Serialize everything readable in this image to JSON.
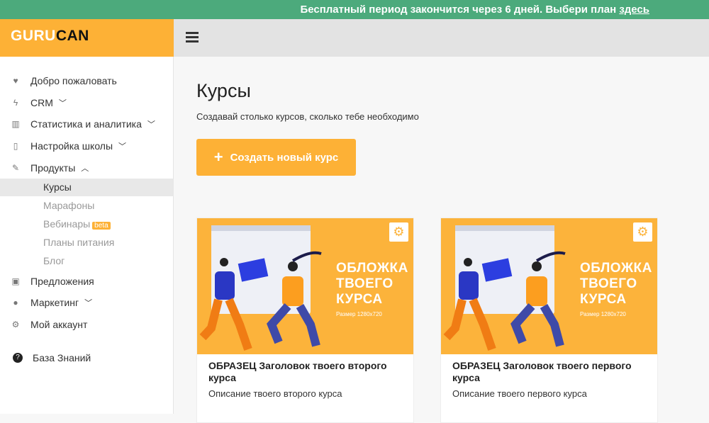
{
  "trial_banner": {
    "text": "Бесплатный период закончится через 6 дней. Выбери план ",
    "link": "здесь"
  },
  "logo": {
    "part1": "GURU",
    "part2": "CAN"
  },
  "sidebar": {
    "items": [
      {
        "label": "Добро пожаловать",
        "icon": "heart-icon"
      },
      {
        "label": "CRM",
        "icon": "bolt-icon"
      },
      {
        "label": "Статистика и аналитика",
        "icon": "chart-icon"
      },
      {
        "label": "Настройка школы",
        "icon": "phone-icon"
      },
      {
        "label": "Продукты",
        "icon": "pencil-icon"
      },
      {
        "label": "Предложения",
        "icon": "money-icon"
      },
      {
        "label": "Маркетинг",
        "icon": "comment-icon"
      },
      {
        "label": "Мой аккаунт",
        "icon": "gear-icon"
      },
      {
        "label": "База Знаний",
        "icon": "question-icon"
      }
    ],
    "products_sub": [
      {
        "label": "Курсы"
      },
      {
        "label": "Марафоны"
      },
      {
        "label": "Вебинары",
        "badge": "beta"
      },
      {
        "label": "Планы питания"
      },
      {
        "label": "Блог"
      }
    ]
  },
  "main": {
    "title": "Курсы",
    "subtitle": "Создавай столько курсов, сколько тебе необходимо",
    "create_button": "Создать новый курс",
    "courses": [
      {
        "cover_text": [
          "ОБЛОЖКА",
          "ТВОЕГО",
          "КУРСА"
        ],
        "cover_size": "Размер 1280x720",
        "title": "ОБРАЗЕЦ Заголовок твоего второго курса",
        "description": "Описание твоего второго курса"
      },
      {
        "cover_text": [
          "ОБЛОЖКА",
          "ТВОЕГО",
          "КУРСА"
        ],
        "cover_size": "Размер 1280x720",
        "title": "ОБРАЗЕЦ Заголовок твоего первого курса",
        "description": "Описание твоего первого курса"
      }
    ]
  },
  "colors": {
    "accent": "#fdb136",
    "banner": "#4caa7c"
  }
}
